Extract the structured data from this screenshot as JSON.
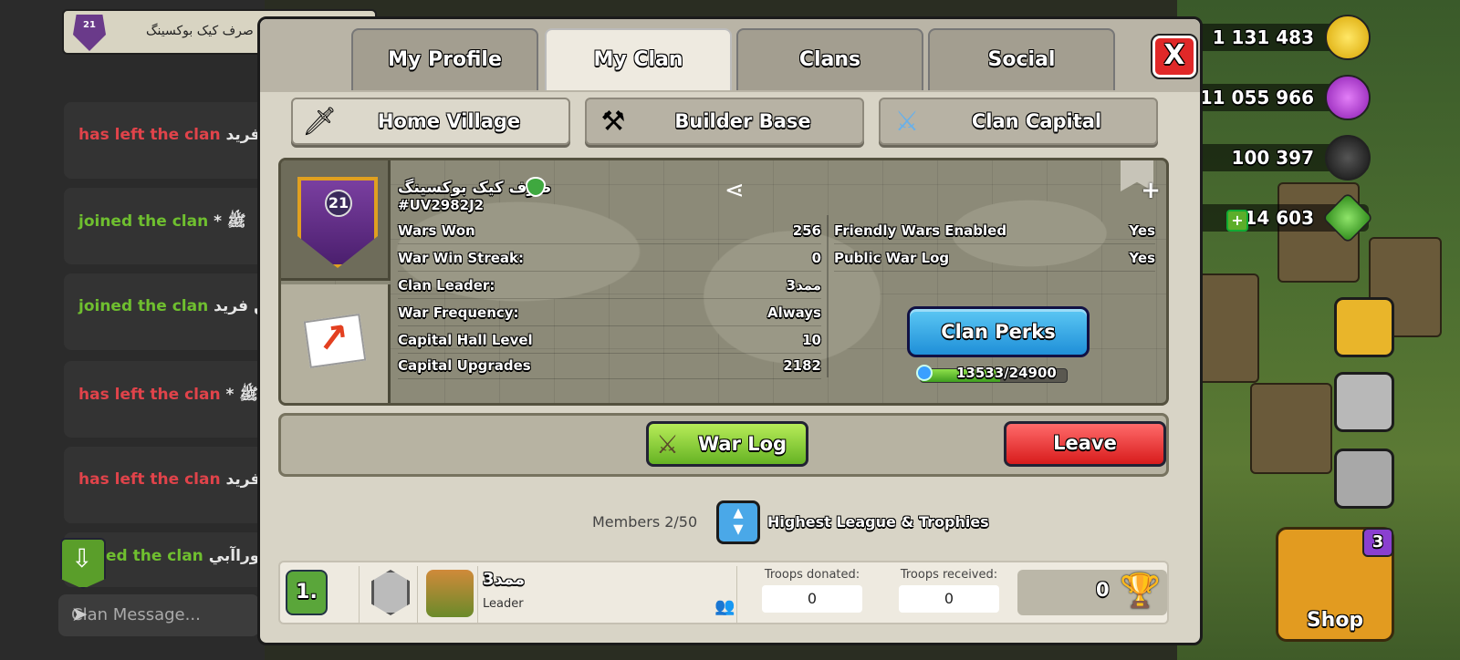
{
  "chat": {
    "clan_banner_level": "21",
    "clan_banner_name": "صرف کیک بوکسینگ",
    "messages": [
      {
        "name": "فرید",
        "text": "has left the clan",
        "kind": "left"
      },
      {
        "name": "* ﷺ",
        "text": "joined the clan",
        "kind": "joined"
      },
      {
        "name": "بن فرید",
        "text": "joined the clan",
        "kind": "joined"
      },
      {
        "name": "* ﷺ",
        "text": "has left the clan",
        "kind": "left"
      },
      {
        "name": "فرید",
        "text": "has left the clan",
        "kind": "left"
      },
      {
        "name": "موراآبي",
        "text": "ed the clan",
        "kind": "joined"
      }
    ],
    "input_placeholder": "Clan Message..."
  },
  "resources": {
    "gold": "1 131 483",
    "elixir": "11 055 966",
    "dark_elixir": "100 397",
    "gems": "14 603"
  },
  "shop": {
    "label": "Shop",
    "badge_count": "3"
  },
  "tabs": [
    {
      "label": "My Profile",
      "active": false
    },
    {
      "label": "My Clan",
      "active": true
    },
    {
      "label": "Clans",
      "active": false
    },
    {
      "label": "Social",
      "active": false
    }
  ],
  "close_label": "X",
  "subtabs": [
    {
      "label": "Home Village",
      "icon": "sword-icon",
      "active": true
    },
    {
      "label": "Builder Base",
      "icon": "axes-icon",
      "active": false
    },
    {
      "label": "Clan Capital",
      "icon": "crossed-swords-icon",
      "active": false
    }
  ],
  "clan": {
    "level": "21",
    "name": "صرف کیک بوکسینگ",
    "tag": "#UV2982J2",
    "stats_left": [
      {
        "label": "Wars Won",
        "value": "256"
      },
      {
        "label": "War Win Streak:",
        "value": "0"
      },
      {
        "label": "Clan Leader:",
        "value": "3ممد"
      },
      {
        "label": "War Frequency:",
        "value": "Always"
      },
      {
        "label": "Capital Hall Level",
        "value": "10"
      },
      {
        "label": "Capital Upgrades",
        "value": "2182"
      }
    ],
    "stats_right": [
      {
        "label": "Friendly Wars Enabled",
        "value": "Yes"
      },
      {
        "label": "Public War Log",
        "value": "Yes"
      }
    ],
    "perks_label": "Clan Perks",
    "perks_progress_text": "13533/24900",
    "perks_progress_fraction": 0.5435
  },
  "actions": {
    "war_log": "War Log",
    "leave": "Leave"
  },
  "members": {
    "count_text": "Members 2/50",
    "sort_label": "Highest League & Trophies"
  },
  "member": {
    "rank": "1.",
    "name": "3ممد",
    "role": "Leader",
    "donated_label": "Troops donated:",
    "donated": "0",
    "received_label": "Troops received:",
    "received": "0",
    "trophies": "0"
  }
}
